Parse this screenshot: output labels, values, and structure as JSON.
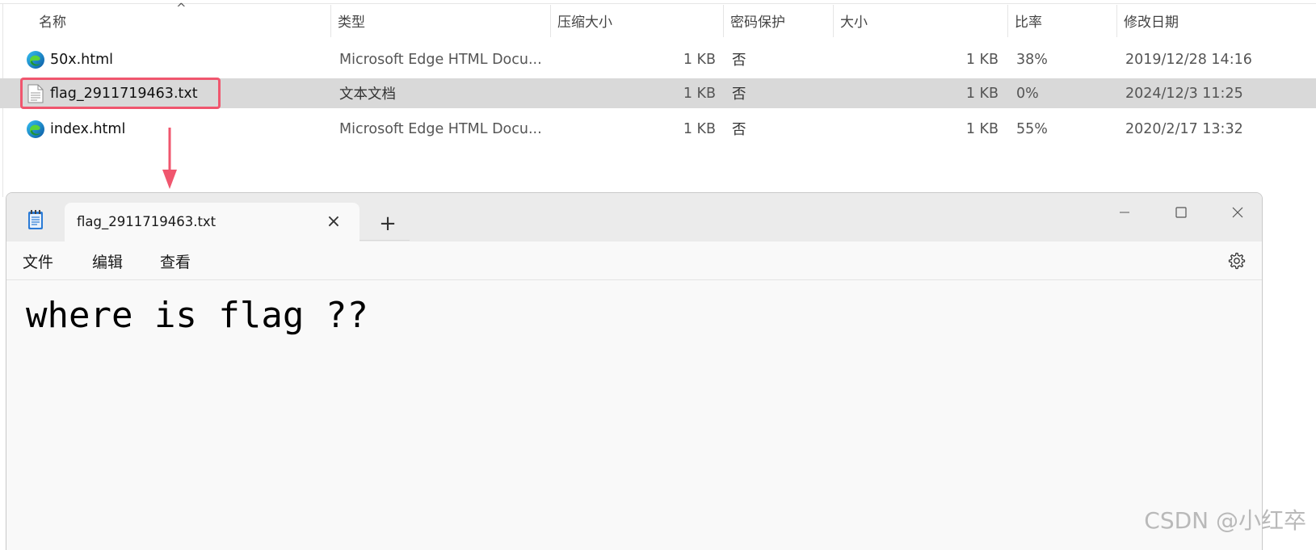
{
  "explorer": {
    "columns": {
      "name": "名称",
      "type": "类型",
      "compressed_size": "压缩大小",
      "password": "密码保护",
      "size": "大小",
      "ratio": "比率",
      "modified": "修改日期"
    },
    "sort_indicator": "^",
    "files": [
      {
        "name": "50x.html",
        "type": "Microsoft Edge HTML Docu...",
        "compressed_size": "1 KB",
        "password": "否",
        "size": "1 KB",
        "ratio": "38%",
        "modified": "2019/12/28 14:16",
        "icon": "edge-icon"
      },
      {
        "name": "flag_2911719463.txt",
        "type": "文本文档",
        "compressed_size": "1 KB",
        "password": "否",
        "size": "1 KB",
        "ratio": "0%",
        "modified": "2024/12/3 11:25",
        "icon": "text-file-icon"
      },
      {
        "name": "index.html",
        "type": "Microsoft Edge HTML Docu...",
        "compressed_size": "1 KB",
        "password": "否",
        "size": "1 KB",
        "ratio": "55%",
        "modified": "2020/2/17 13:32",
        "icon": "edge-icon"
      }
    ],
    "selected_index": 1,
    "highlight_color": "#f0566e"
  },
  "notepad": {
    "tab_title": "flag_2911719463.txt",
    "tab_close_glyph": "×",
    "tab_add_glyph": "+",
    "menu": {
      "file": "文件",
      "edit": "编辑",
      "view": "查看"
    },
    "content": "where is flag ??"
  },
  "watermark": "CSDN @小红卒"
}
